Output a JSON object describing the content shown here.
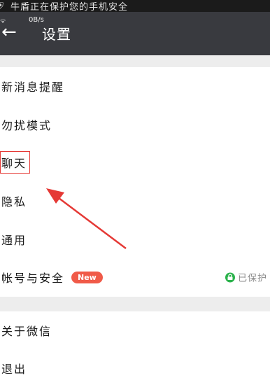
{
  "status_bar": {
    "text": "牛盾正在保护您的手机安全",
    "speed": "0B/s"
  },
  "title_bar": {
    "back_glyph": "←",
    "title": "设置"
  },
  "menu_primary": [
    {
      "label": "新消息提醒"
    },
    {
      "label": "勿扰模式"
    },
    {
      "label": "聊天"
    },
    {
      "label": "隐私"
    },
    {
      "label": "通用"
    },
    {
      "label": "帐号与安全",
      "badge": "New",
      "status": "已保护"
    }
  ],
  "menu_secondary": [
    {
      "label": "关于微信"
    },
    {
      "label": "退出"
    }
  ],
  "colors": {
    "accent_red": "#e53935",
    "badge_red": "#f05a48",
    "protect_green": "#2bb24c",
    "title_bg": "#393a3f"
  }
}
